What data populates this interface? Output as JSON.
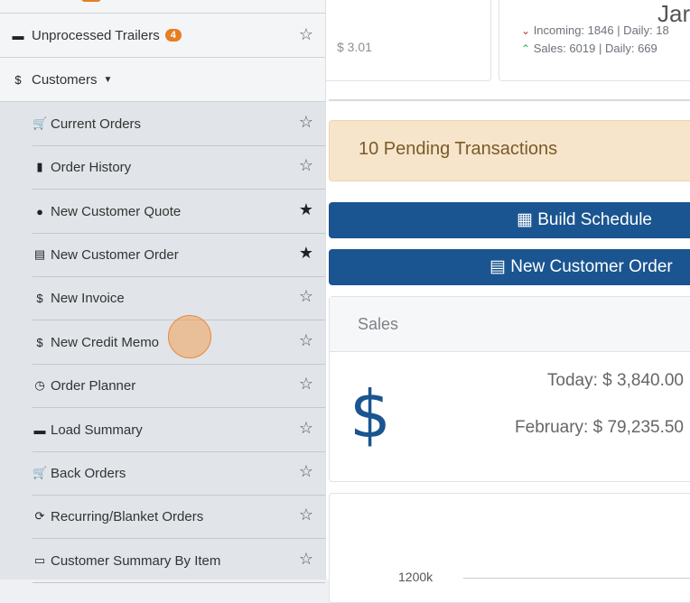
{
  "header_cards": {
    "card1_value": "$ 3.01",
    "card2_big": "Jar",
    "incoming_line": "Incoming: 1846 | Daily: 18",
    "sales_line": "Sales: 6019 | Daily: 669"
  },
  "pending": {
    "label": "10 Pending Transactions"
  },
  "buttons": {
    "build_schedule": "Build Schedule",
    "new_customer_order": "New Customer Order"
  },
  "sales_card": {
    "title": "Sales",
    "dollar_symbol": "$",
    "today": "Today: $ 3,840.00",
    "month": "February: $ 79,235.50"
  },
  "chart_card": {
    "tick": "1200k"
  },
  "sidebar": {
    "unprocessed_trailers": {
      "label": "Unprocessed Trailers",
      "badge": "4",
      "icon": "truck-icon"
    },
    "customers": {
      "label": "Customers",
      "icon": "dollar-icon"
    },
    "items": [
      {
        "label": "Current Orders",
        "icon": "cart-icon",
        "starred": false
      },
      {
        "label": "Order History",
        "icon": "file-icon",
        "starred": false
      },
      {
        "label": "New Customer Quote",
        "icon": "comment-icon",
        "starred": true
      },
      {
        "label": "New Customer Order",
        "icon": "doc-icon",
        "starred": true
      },
      {
        "label": "New Invoice",
        "icon": "dollar-icon",
        "starred": false
      },
      {
        "label": "New Credit Memo",
        "icon": "dollar-icon",
        "starred": false
      },
      {
        "label": "Order Planner",
        "icon": "clock-icon",
        "starred": false
      },
      {
        "label": "Load Summary",
        "icon": "truck-icon",
        "starred": false
      },
      {
        "label": "Back Orders",
        "icon": "cart-icon",
        "starred": false
      },
      {
        "label": "Recurring/Blanket Orders",
        "icon": "refresh-icon",
        "starred": false
      },
      {
        "label": "Customer Summary By Item",
        "icon": "table-icon",
        "starred": false
      }
    ]
  }
}
